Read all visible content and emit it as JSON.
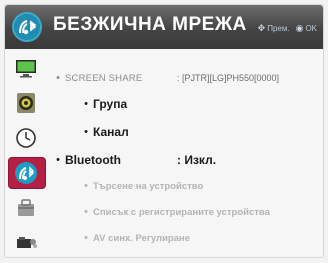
{
  "header": {
    "title": "БЕЗЖИЧНА МРЕЖА",
    "hint_move": "Прем.",
    "hint_ok": "OK",
    "icon": "bluetooth-network-icon"
  },
  "sidebar": {
    "items": [
      {
        "icon": "monitor-icon",
        "active": false
      },
      {
        "icon": "speaker-icon",
        "active": false
      },
      {
        "icon": "clock-icon",
        "active": false
      },
      {
        "icon": "network-icon",
        "active": true
      },
      {
        "icon": "lock-icon",
        "active": false
      },
      {
        "icon": "camera-icon",
        "active": false
      }
    ]
  },
  "menu": {
    "screen_share": {
      "label": "SCREEN SHARE",
      "value": ": [PJTR][LG]PH550[0000]"
    },
    "group": {
      "label": "Група"
    },
    "channel": {
      "label": "Канал"
    },
    "bluetooth": {
      "label": "Bluetooth",
      "value": ": Изкл."
    },
    "search_device": {
      "label": "Търсене на устройство"
    },
    "registered_list": {
      "label": "Списък с регистрираните устройства"
    },
    "av_sync": {
      "label": "AV синх. Регулиране"
    }
  },
  "colors": {
    "header_bg": "#444444",
    "accent_active": "#b41f46",
    "text_dim": "#b4b4b4"
  }
}
